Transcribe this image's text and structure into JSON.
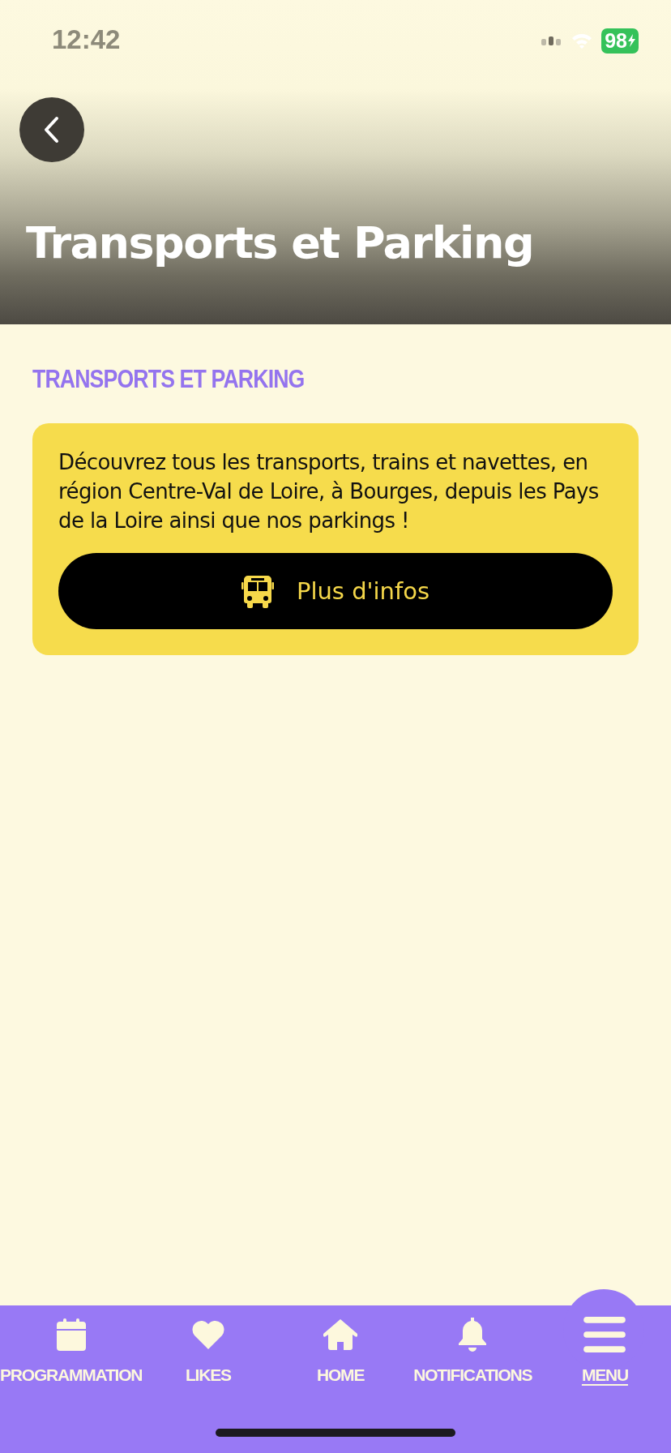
{
  "status_bar": {
    "time": "12:42",
    "battery": "98"
  },
  "header": {
    "title": "Transports et Parking"
  },
  "section": {
    "heading": "TRANSPORTS ET PARKING"
  },
  "card": {
    "text": "Découvrez tous les transports, trains et navettes, en région Centre-Val de Loire, à Bourges, depuis les Pays de la Loire ainsi que nos parkings !",
    "button": "Plus d'infos"
  },
  "nav": [
    {
      "kind": "calendar",
      "label": "PROGRAMMATION",
      "selected": false
    },
    {
      "kind": "heart",
      "label": "LIKES",
      "selected": false
    },
    {
      "kind": "home",
      "label": "HOME",
      "selected": false
    },
    {
      "kind": "bell",
      "label": "NOTIFICATIONS",
      "selected": false
    },
    {
      "kind": "menu",
      "label": "MENU",
      "selected": true
    }
  ]
}
